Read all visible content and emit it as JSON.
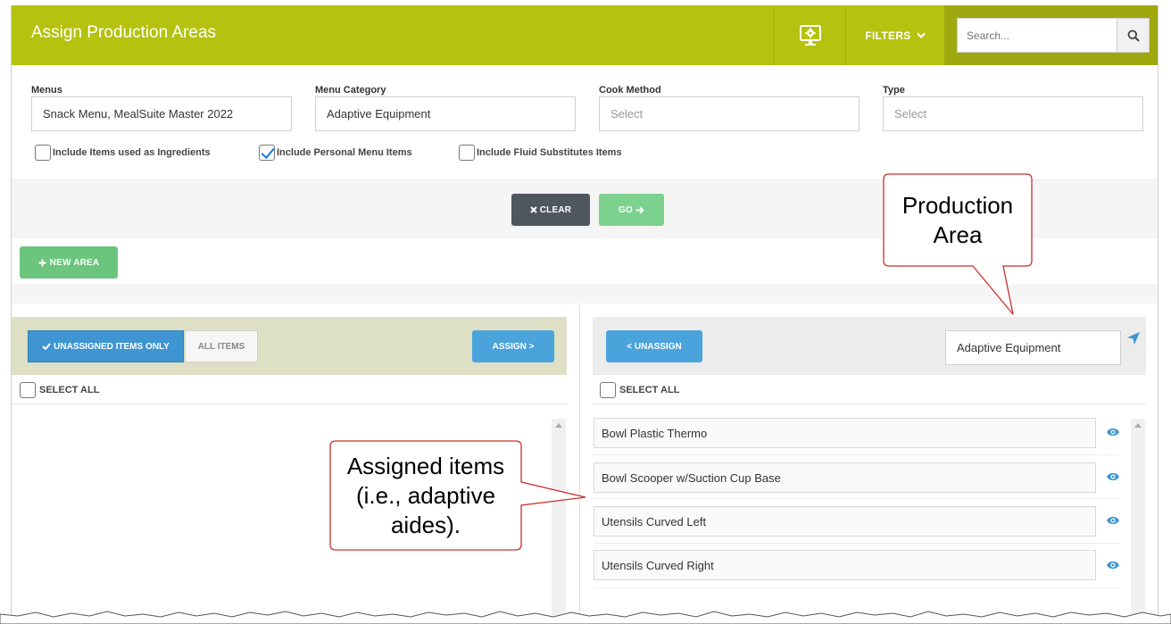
{
  "header": {
    "title": "Assign Production Areas",
    "filters_label": "FILTERS",
    "search_placeholder": "Search...",
    "accent_color": "#b5c210"
  },
  "filters": {
    "menus": {
      "label": "Menus",
      "value": "Snack Menu, MealSuite Master 2022"
    },
    "menu_category": {
      "label": "Menu Category",
      "value": "Adaptive Equipment"
    },
    "cook_method": {
      "label": "Cook Method",
      "placeholder": "Select"
    },
    "type": {
      "label": "Type",
      "placeholder": "Select"
    },
    "checkboxes": [
      {
        "label": "Include Items used as Ingredients",
        "checked": false
      },
      {
        "label": "Include Personal Menu Items",
        "checked": true
      },
      {
        "label": "Include Fluid Substitutes Items",
        "checked": false
      }
    ]
  },
  "actions": {
    "clear_label": "CLEAR",
    "go_label": "GO",
    "new_area_label": "NEW AREA"
  },
  "left_panel": {
    "tab_unassigned": "UNASSIGNED ITEMS ONLY",
    "tab_all": "ALL ITEMS",
    "assign_label": "ASSIGN >",
    "select_all": "SELECT ALL"
  },
  "right_panel": {
    "unassign_label": "< UNASSIGN",
    "area_value": "Adaptive Equipment",
    "select_all": "SELECT ALL",
    "items": [
      "Bowl Plastic Thermo",
      "Bowl Scooper w/Suction Cup Base",
      "Utensils Curved Left",
      "Utensils Curved Right"
    ]
  },
  "callouts": {
    "production_area": [
      "Production",
      "Area"
    ],
    "assigned_items": [
      "Assigned items",
      "(i.e., adaptive",
      "aides)."
    ]
  }
}
